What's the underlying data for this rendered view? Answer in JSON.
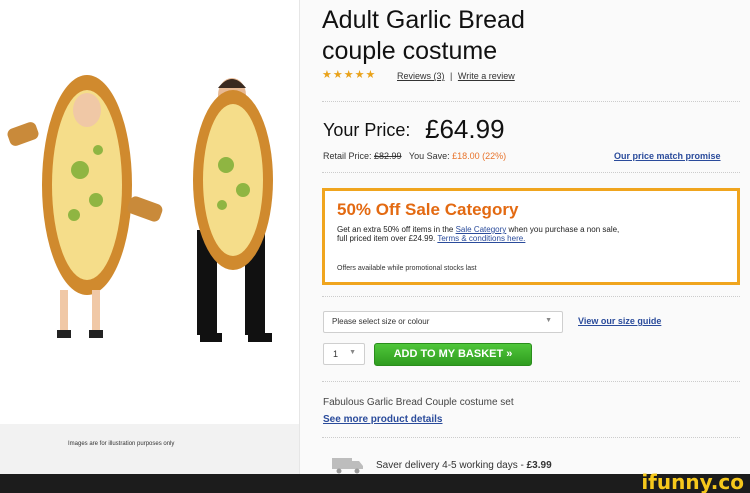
{
  "product": {
    "title": "Adult Garlic Bread couple costume",
    "rating_stars": 5,
    "reviews_label": "Reviews (3)",
    "write_review_label": "Write a review",
    "separator": "|"
  },
  "price": {
    "your_price_label": "Your Price:",
    "your_price_value": "£64.99",
    "retail_label": "Retail Price:",
    "retail_value": "£82.99",
    "save_label": "You Save:",
    "save_value": "£18.00 (22%)",
    "promise_link": "Our price match promise"
  },
  "sale_box": {
    "title": "50% Off Sale Category",
    "text_1": "Get an extra 50% off items in the ",
    "sale_category_link": "Sale Category",
    "text_2": " when you purchase a non sale, full priced item over £24.99. ",
    "terms_link": "Terms & conditions here.",
    "note": "Offers available while promotional stocks last"
  },
  "purchase": {
    "size_select_value": "Please select size or colour",
    "size_guide_link": "View our size guide",
    "quantity_value": "1",
    "basket_button": "ADD TO MY BASKET »"
  },
  "description": {
    "text": "Fabulous Garlic Bread Couple costume set",
    "more_link": "See more product details"
  },
  "delivery": {
    "text": "Saver delivery 4-5 working days - ",
    "price": "£3.99"
  },
  "image_caption": "Images are for illustration purposes only",
  "watermark": "ifunny.co",
  "colors": {
    "accent_orange": "#e36a12",
    "box_border": "#f0a51e",
    "link_blue": "#2a4b9b",
    "button_green": "#3fb02b",
    "star_gold": "#e9a21a"
  }
}
